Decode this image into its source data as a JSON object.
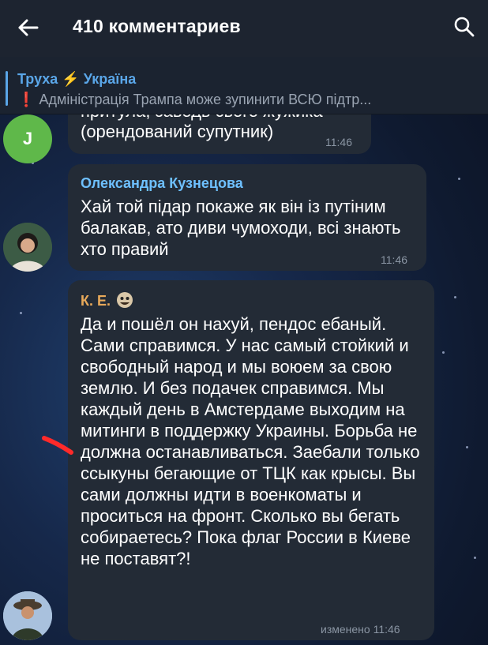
{
  "header": {
    "title": "410 комментариев"
  },
  "pinned": {
    "channel_name": "Труха",
    "channel_bolt": "⚡",
    "channel_suffix": "Україна",
    "excl": "❗",
    "text": "Адміністрація Трампа може зупинити ВСЮ підтр..."
  },
  "messages": [
    {
      "avatar_letter": "J",
      "partial_line": "притула, заводь свого жужика",
      "text": "(орендований супутник)",
      "time": "11:46"
    },
    {
      "sender": "Олександра Кузнецова",
      "text": "Хай той підар покаже як він із путіним балакав, ато диви чумоходи, всі знають хто правий",
      "time": "11:46"
    },
    {
      "sender": "К. Е.",
      "text": "Да и пошёл он нахуй, пендос ебаный. Сами справимся. У нас самый стойкий и свободный народ и мы воюем за свою землю. И без подачек справимся. Мы каждый день в Амстердаме выходим на митинги в поддержку Украины. Борьба не должна останавливаться. Заебали только ссыкуны бегающие от ТЦК как крысы. Вы сами должны идти в военкоматы и проситься на фронт. Сколько вы бегать собираетесь? Пока флаг России в Киеве не поставят?!",
      "time": "изменено 11:46"
    }
  ],
  "colors": {
    "sender_1": "#6ec0ff",
    "sender_2": "#e8a95a",
    "accent": "#5aa6e8"
  }
}
